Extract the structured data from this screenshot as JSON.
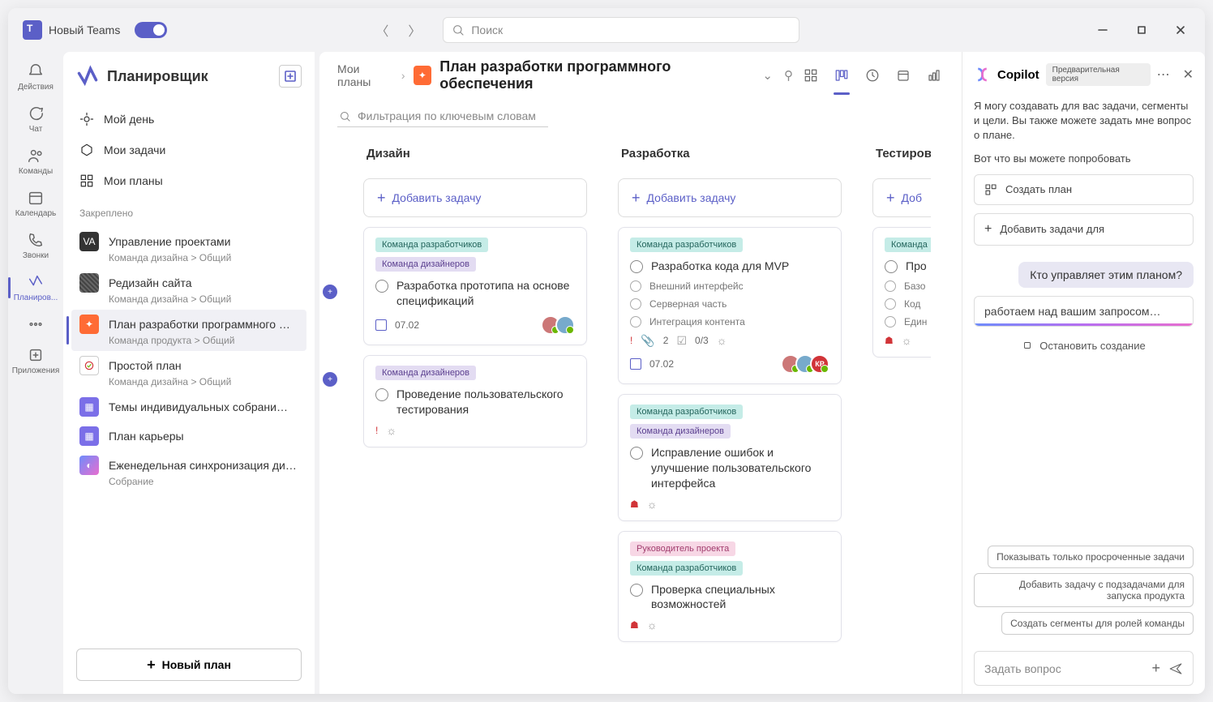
{
  "titlebar": {
    "brand": "Новый Teams",
    "search_placeholder": "Поиск"
  },
  "rail": {
    "activity": "Действия",
    "chat": "Чат",
    "teams": "Команды",
    "calendar": "Календарь",
    "calls": "Звонки",
    "planner": "Планиров...",
    "apps": "Приложения"
  },
  "sidebar": {
    "title": "Планировщик",
    "my_day": "Мой день",
    "my_tasks": "Мои задачи",
    "my_plans": "Мои планы",
    "pinned_label": "Закреплено",
    "pinned": [
      {
        "title": "Управление проектами",
        "sub": "Команда дизайна > Общий",
        "color": "#333"
      },
      {
        "title": "Редизайн сайта",
        "sub": "Команда дизайна > Общий",
        "color": "#4a4a6a"
      },
      {
        "title": "План разработки программного …",
        "sub": "Команда продукта > Общий",
        "color": "#ff6b35"
      },
      {
        "title": "Простой план",
        "sub": "Команда дизайна > Общий",
        "color": "#fff"
      },
      {
        "title": "Темы индивидуальных собрани…",
        "sub": "",
        "color": "#7b6fe8"
      },
      {
        "title": "План карьеры",
        "sub": "",
        "color": "#7b6fe8"
      },
      {
        "title": "Еженедельная синхронизация ди…",
        "sub": "Собрание",
        "color": "#e86ecf"
      }
    ],
    "new_plan": "Новый план"
  },
  "breadcrumb": {
    "root": "Мои планы",
    "plan": "План разработки программного обеспечения"
  },
  "filter_placeholder": "Фильтрация по ключевым словам",
  "board": {
    "add_task": "Добавить задачу",
    "add_task_short": "Доб",
    "columns": [
      {
        "name": "Дизайн",
        "cards": [
          {
            "tags": [
              {
                "t": "Команда разработчиков",
                "c": "teal"
              },
              {
                "t": "Команда дизайнеров",
                "c": "purple"
              }
            ],
            "title": "Разработка прототипа на основе спецификаций",
            "date": "07.02",
            "avatars": 2
          },
          {
            "tags": [
              {
                "t": "Команда дизайнеров",
                "c": "purple"
              }
            ],
            "title": "Проведение пользовательского тестирования",
            "urgent": true
          }
        ]
      },
      {
        "name": "Разработка",
        "cards": [
          {
            "tags": [
              {
                "t": "Команда разработчиков",
                "c": "teal"
              }
            ],
            "title": "Разработка кода для MVP",
            "subs": [
              "Внешний интерфейс",
              "Серверная часть",
              "Интеграция контента"
            ],
            "attach": "2",
            "check": "0/3",
            "urgent": true,
            "date": "07.02",
            "avatars": 3
          },
          {
            "tags": [
              {
                "t": "Команда разработчиков",
                "c": "teal"
              },
              {
                "t": "Команда дизайнеров",
                "c": "purple"
              }
            ],
            "title": "Исправление ошибок и улучшение пользовательского интерфейса",
            "flag": true
          },
          {
            "tags": [
              {
                "t": "Руководитель проекта",
                "c": "pink"
              },
              {
                "t": "Команда разработчиков",
                "c": "teal"
              }
            ],
            "title": "Проверка специальных возможностей",
            "flag": true
          }
        ]
      },
      {
        "name": "Тестирован",
        "cards": [
          {
            "tags": [
              {
                "t": "Команда",
                "c": "teal"
              }
            ],
            "title": "Про"
          },
          {
            "sublabels": [
              "Базо",
              "Код",
              "Един"
            ],
            "flag": true
          }
        ]
      }
    ]
  },
  "copilot": {
    "title": "Copilot",
    "badge": "Предварительная версия",
    "intro1": "Я могу создавать для вас задачи, сегменты и цели. Вы также можете задать мне вопрос о плане.",
    "intro2": "Вот что вы можете попробовать",
    "opt1": "Создать план",
    "opt2": "Добавить задачи для",
    "user_msg": "Кто управляет этим планом?",
    "working": "работаем над вашим запросом…",
    "stop": "Остановить создание",
    "sugg": [
      "Показывать только просроченные задачи",
      "Добавить задачу с подзадачами для запуска продукта",
      "Создать сегменты для ролей команды"
    ],
    "input_placeholder": "Задать вопрос"
  }
}
